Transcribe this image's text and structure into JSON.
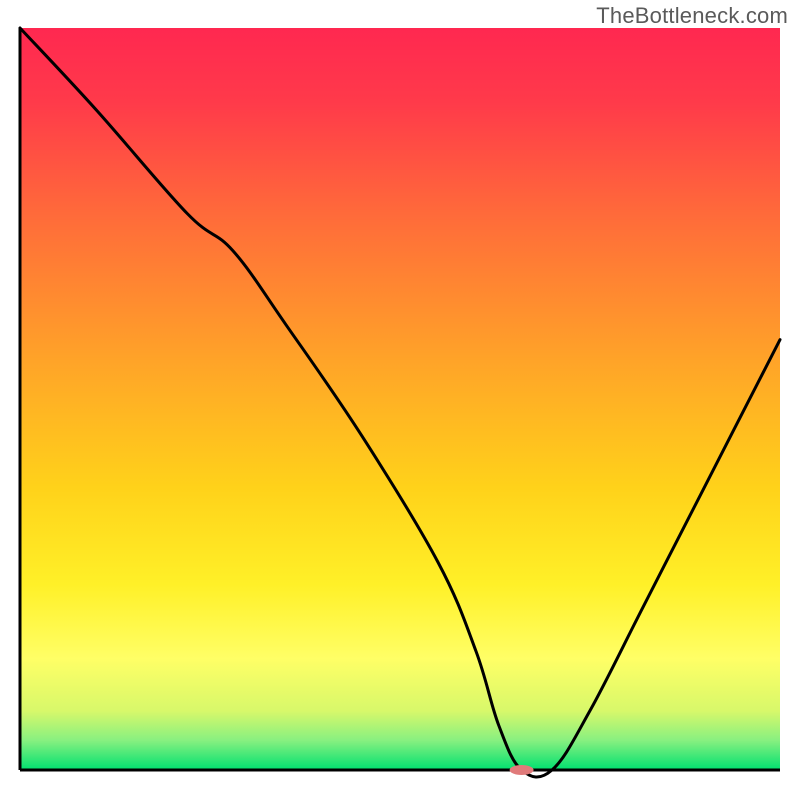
{
  "watermark": "TheBottleneck.com",
  "chart_data": {
    "type": "line",
    "title": "",
    "xlabel": "",
    "ylabel": "",
    "xlim": [
      0,
      100
    ],
    "ylim": [
      0,
      100
    ],
    "legend": false,
    "grid": false,
    "background_gradient_top": "#ff2850",
    "background_gradient_mid": "#ffc800",
    "background_gradient_low": "#ffff66",
    "background_gradient_bottom": "#00e070",
    "marker": {
      "x": 66,
      "y": 0,
      "color": "#e07a7a",
      "rx": 12,
      "ry": 5
    },
    "series": [
      {
        "name": "bottleneck-curve",
        "color": "#000000",
        "x": [
          0,
          10,
          22,
          28,
          35,
          45,
          55,
          60,
          63,
          66,
          70,
          75,
          82,
          90,
          100
        ],
        "values": [
          100,
          89,
          75,
          70,
          60,
          45,
          28,
          16,
          6,
          0,
          0,
          8,
          22,
          38,
          58
        ]
      }
    ]
  }
}
